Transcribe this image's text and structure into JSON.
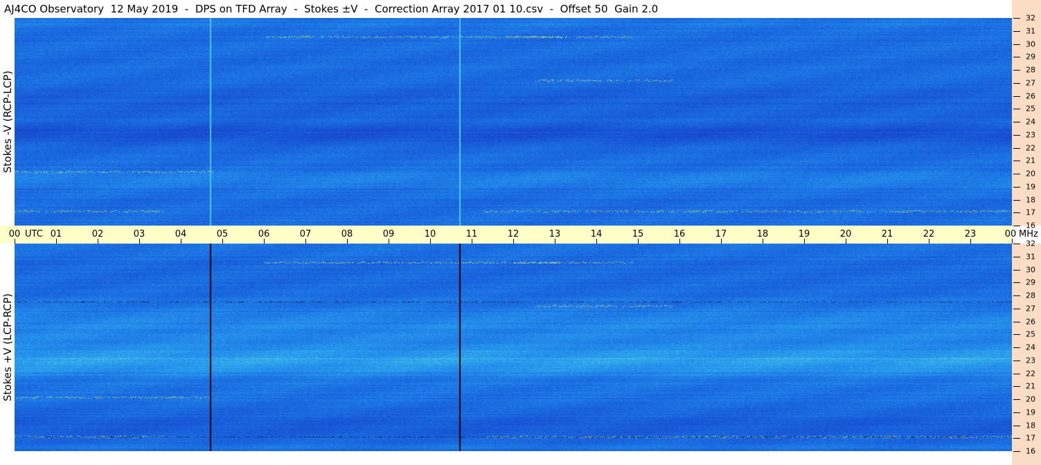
{
  "title": "AJ4CO Observatory  12 May 2019  -  DPS on TFD Array  -  Stokes ±V  -  Correction Array 2017 01 10.csv  -  Offset 50  Gain 2.0",
  "chart_data": [
    {
      "type": "heatmap",
      "panel": "top",
      "ylabel": "Stokes -V (RCP-LCP)",
      "x_unit": "UTC",
      "y_unit": "MHz",
      "xlim": [
        "00",
        "00"
      ],
      "ylim": [
        16,
        32
      ],
      "y_ticks": [
        "32",
        "31",
        "30",
        "29",
        "28",
        "27",
        "26",
        "25",
        "24",
        "23",
        "22",
        "21",
        "20",
        "19",
        "18",
        "17",
        "16"
      ],
      "colormap": [
        "#0a1f7a",
        "#1640c8",
        "#1a6ae0",
        "#2aa0f0",
        "#6ee8c8",
        "#f0f050",
        "#ff5050"
      ],
      "vertical_marks_utc": [
        4.7,
        10.7
      ],
      "vertical_mark_color": "#45c8e8"
    },
    {
      "type": "heatmap",
      "panel": "bottom",
      "ylabel": "Stokes +V (LCP-RCP)",
      "x_unit": "UTC",
      "y_unit": "MHz",
      "xlim": [
        "00",
        "00"
      ],
      "ylim": [
        16,
        32
      ],
      "y_ticks": [
        "32",
        "31",
        "30",
        "29",
        "28",
        "27",
        "26",
        "25",
        "24",
        "23",
        "22",
        "21",
        "20",
        "19",
        "18",
        "17",
        "16"
      ],
      "colormap": [
        "#0a1f7a",
        "#1640c8",
        "#1a6ae0",
        "#2aa0f0",
        "#6ee8c8",
        "#f0f050",
        "#ff5050"
      ],
      "vertical_marks_utc": [
        4.7,
        10.7
      ],
      "vertical_mark_color": "#000000"
    }
  ],
  "time_axis": {
    "labels": [
      "00",
      "01",
      "02",
      "03",
      "04",
      "05",
      "06",
      "07",
      "08",
      "09",
      "10",
      "11",
      "12",
      "13",
      "14",
      "15",
      "16",
      "17",
      "18",
      "19",
      "20",
      "21",
      "22",
      "23",
      "00"
    ],
    "utc_label": "UTC",
    "mhz_label": "MHz"
  }
}
